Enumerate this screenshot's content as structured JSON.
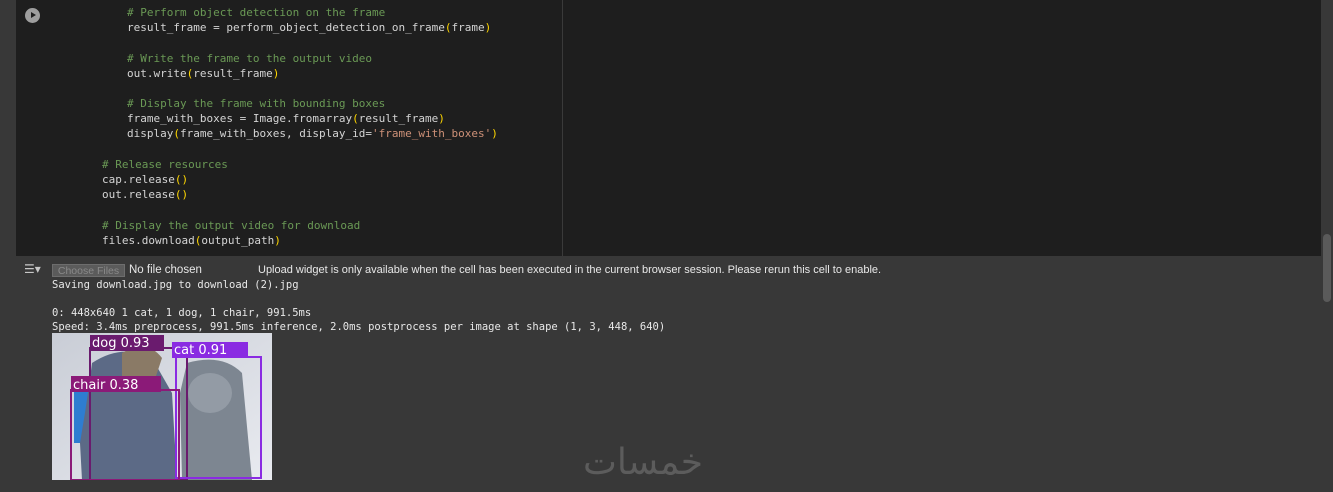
{
  "code_lines": [
    {
      "indent": 111,
      "parts": [
        {
          "t": "# Perform object detection on the frame",
          "c": "c-com"
        }
      ]
    },
    {
      "indent": 111,
      "parts": [
        {
          "t": "result_frame = perform_object_detection_on_frame",
          "c": "c-def"
        },
        {
          "t": "(",
          "c": "c-yel"
        },
        {
          "t": "frame",
          "c": "c-def"
        },
        {
          "t": ")",
          "c": "c-yel"
        }
      ]
    },
    {
      "indent": 111,
      "parts": []
    },
    {
      "indent": 111,
      "parts": [
        {
          "t": "# Write the frame to the output video",
          "c": "c-com"
        }
      ]
    },
    {
      "indent": 111,
      "parts": [
        {
          "t": "out.write",
          "c": "c-def"
        },
        {
          "t": "(",
          "c": "c-yel"
        },
        {
          "t": "result_frame",
          "c": "c-def"
        },
        {
          "t": ")",
          "c": "c-yel"
        }
      ]
    },
    {
      "indent": 111,
      "parts": []
    },
    {
      "indent": 111,
      "parts": [
        {
          "t": "# Display the frame with bounding boxes",
          "c": "c-com"
        }
      ]
    },
    {
      "indent": 111,
      "parts": [
        {
          "t": "frame_with_boxes = Image.fromarray",
          "c": "c-def"
        },
        {
          "t": "(",
          "c": "c-yel"
        },
        {
          "t": "result_frame",
          "c": "c-def"
        },
        {
          "t": ")",
          "c": "c-yel"
        }
      ]
    },
    {
      "indent": 111,
      "parts": [
        {
          "t": "display",
          "c": "c-def"
        },
        {
          "t": "(",
          "c": "c-yel"
        },
        {
          "t": "frame_with_boxes, display_id=",
          "c": "c-def"
        },
        {
          "t": "'frame_with_boxes'",
          "c": "c-str"
        },
        {
          "t": ")",
          "c": "c-yel"
        }
      ]
    },
    {
      "indent": 86,
      "parts": []
    },
    {
      "indent": 86,
      "parts": [
        {
          "t": "# Release resources",
          "c": "c-com"
        }
      ]
    },
    {
      "indent": 86,
      "parts": [
        {
          "t": "cap.release",
          "c": "c-def"
        },
        {
          "t": "()",
          "c": "c-yel"
        }
      ]
    },
    {
      "indent": 86,
      "parts": [
        {
          "t": "out.release",
          "c": "c-def"
        },
        {
          "t": "()",
          "c": "c-yel"
        }
      ]
    },
    {
      "indent": 86,
      "parts": []
    },
    {
      "indent": 86,
      "parts": [
        {
          "t": "# Display the output video for download",
          "c": "c-com"
        }
      ]
    },
    {
      "indent": 86,
      "parts": [
        {
          "t": "files.download",
          "c": "c-def"
        },
        {
          "t": "(",
          "c": "c-yel"
        },
        {
          "t": "output_path",
          "c": "c-def"
        },
        {
          "t": ")",
          "c": "c-yel"
        }
      ]
    }
  ],
  "output": {
    "choose_files_label": "Choose Files",
    "no_file_label": "No file chosen",
    "upload_message": "Upload widget is only available when the cell has been executed in the current browser session. Please rerun this cell to enable.",
    "lines": [
      "Saving download.jpg to download (2).jpg",
      "",
      "0: 448x640 1 cat, 1 dog, 1 chair, 991.5ms",
      "Speed: 3.4ms preprocess, 991.5ms inference, 2.0ms postprocess per image at shape (1, 3, 448, 640)"
    ],
    "detections": [
      {
        "label": "dog 0.93",
        "color": "#6a1b6e"
      },
      {
        "label": "cat 0.91",
        "color": "#8a2be2"
      },
      {
        "label": "chair 0.38",
        "color": "#8b1a78"
      }
    ]
  },
  "watermark": "خمسات"
}
